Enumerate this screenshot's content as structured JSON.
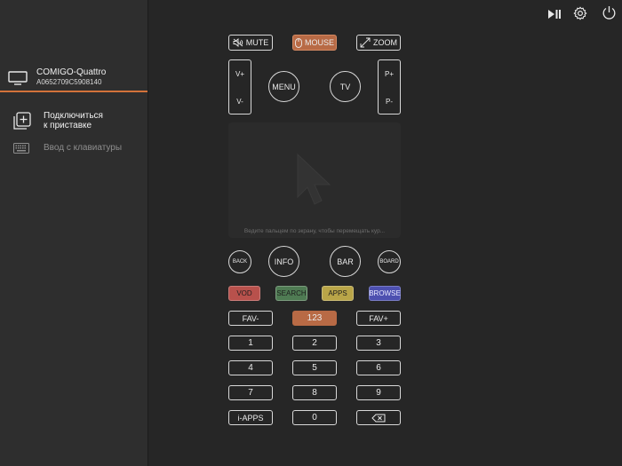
{
  "sidebar": {
    "device_name": "COMIGO-Quattro",
    "device_serial": "A0652709C5908140",
    "connect_label_line1": "Подключиться",
    "connect_label_line2": "к приставке",
    "keyboard_label": "Ввод с клавиатуры"
  },
  "remote": {
    "mute": "MUTE",
    "mouse": "MOUSE",
    "zoom": "ZOOM",
    "vol_up": "V+",
    "vol_down": "V-",
    "menu": "MENU",
    "tv": "TV",
    "ch_up": "P+",
    "ch_down": "P-",
    "touchpad_hint": "Ведите пальцем по экрану, чтобы перемещать кур...",
    "back": "BACK",
    "info": "INFO",
    "bar": "BAR",
    "board": "BOARD",
    "vod": "VOD",
    "search": "SEARCH",
    "apps": "APPS",
    "browse": "BROWSE",
    "fav_minus": "FAV-",
    "num_mode": "123",
    "fav_plus": "FAV+",
    "keys": [
      "1",
      "2",
      "3",
      "4",
      "5",
      "6",
      "7",
      "8",
      "9"
    ],
    "iapps": "i-APPS",
    "zero": "0"
  },
  "colors": {
    "accent": "#d2723a",
    "mouse_bg": "#b86a45",
    "vod": "#b8514c",
    "search": "#4f7b53",
    "apps": "#b9a548",
    "browse": "#4d50b0"
  }
}
